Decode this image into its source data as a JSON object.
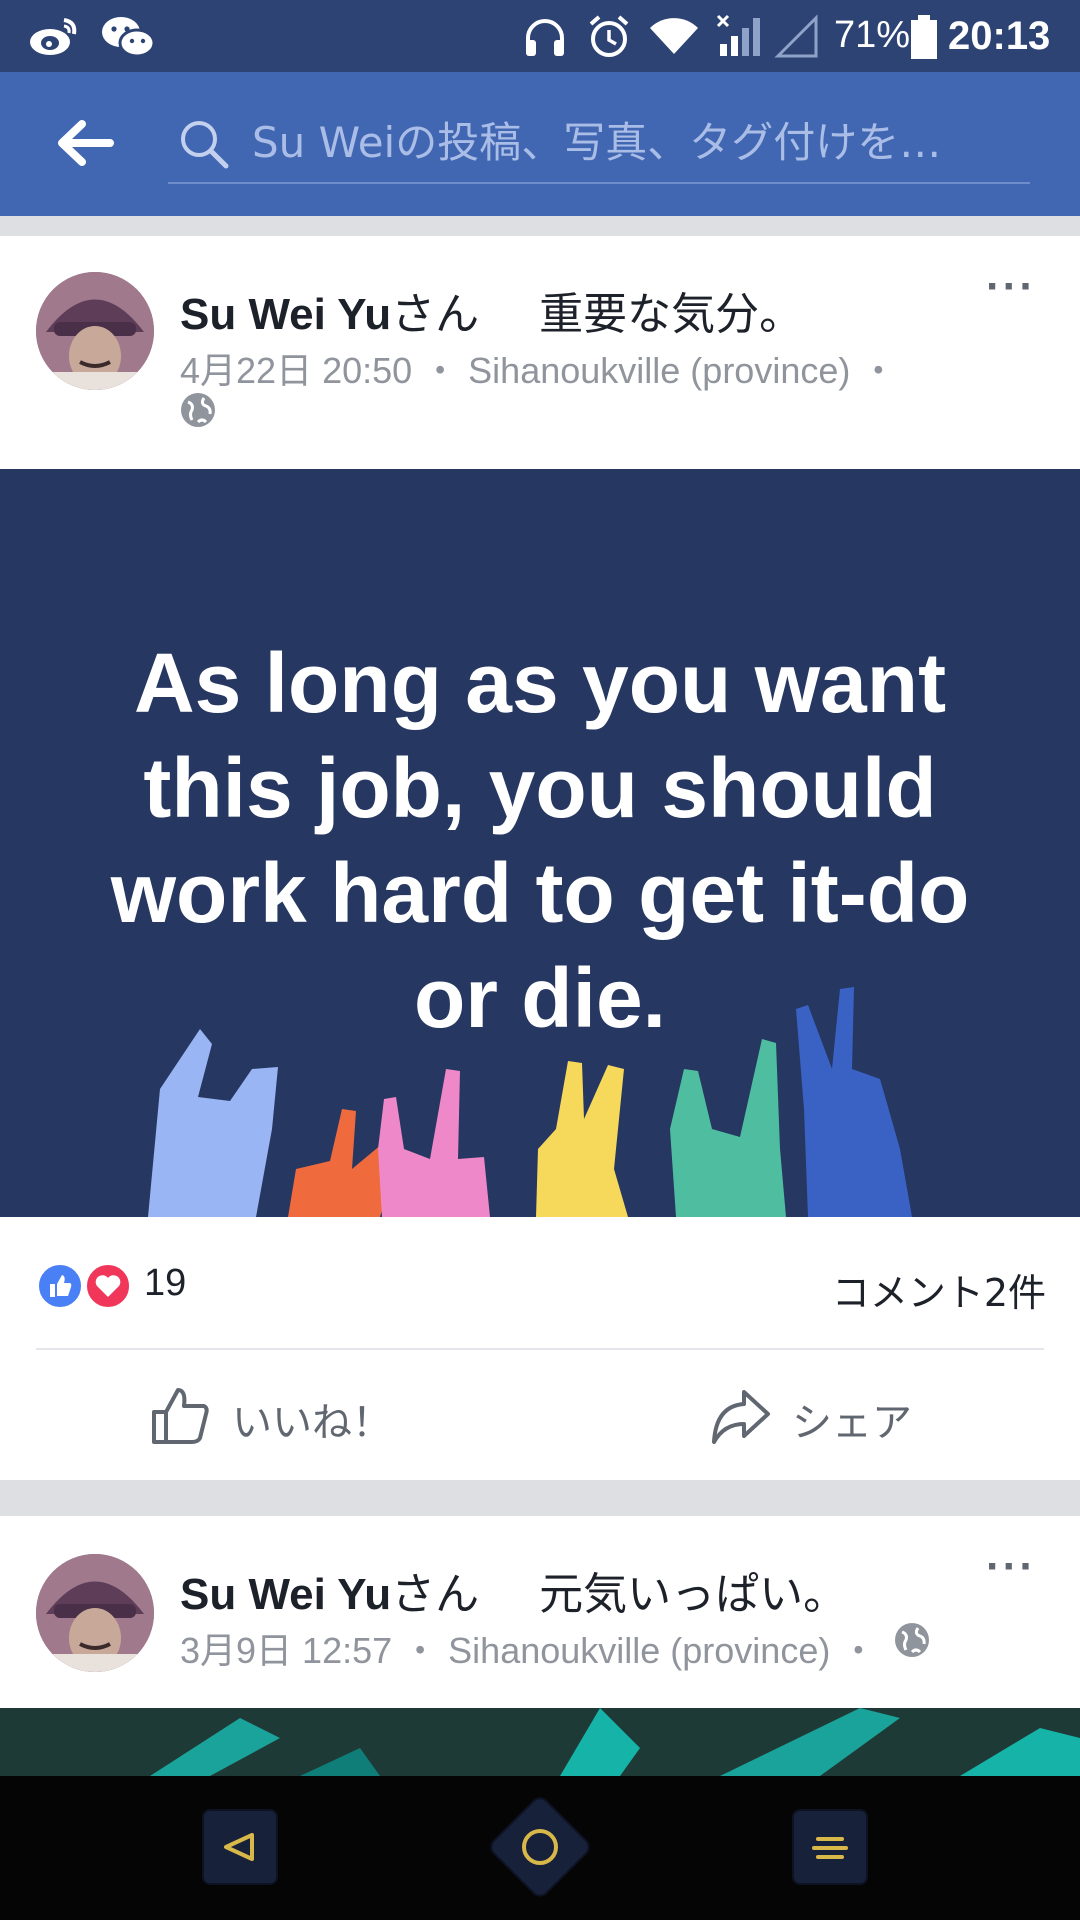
{
  "status_bar": {
    "battery_percent": "71%",
    "time": "20:13",
    "icons": [
      "weibo-icon",
      "wechat-icon",
      "headphones-icon",
      "alarm-icon",
      "wifi-icon",
      "signal-icon",
      "signal-empty-icon",
      "battery-icon"
    ]
  },
  "header": {
    "search_placeholder": "Su Weiの投稿、写真、タグ付けを…"
  },
  "posts": [
    {
      "author": "Su Wei Yu",
      "suffix": "さん",
      "feeling": "重要な気分。",
      "date": "4月22日 20:50",
      "location": "Sihanoukville (province)",
      "separator": "・",
      "quote": "As long as you want this job, you should work hard to get it-do or die.",
      "reaction_count": "19",
      "comments": "コメント2件",
      "like_label": "いいね！",
      "share_label": "シェア"
    },
    {
      "author": "Su Wei Yu",
      "suffix": "さん",
      "feeling": "元気いっぱい。",
      "date": "3月9日 12:57",
      "location": "Sihanoukville (province)",
      "separator": "・"
    }
  ],
  "more_label": "···",
  "colors": {
    "status_bar": "#2d4373",
    "app_bar": "#4267b2",
    "quote_bg": "#263762",
    "like_blue": "#4a80f5",
    "love_red": "#f0375a"
  }
}
